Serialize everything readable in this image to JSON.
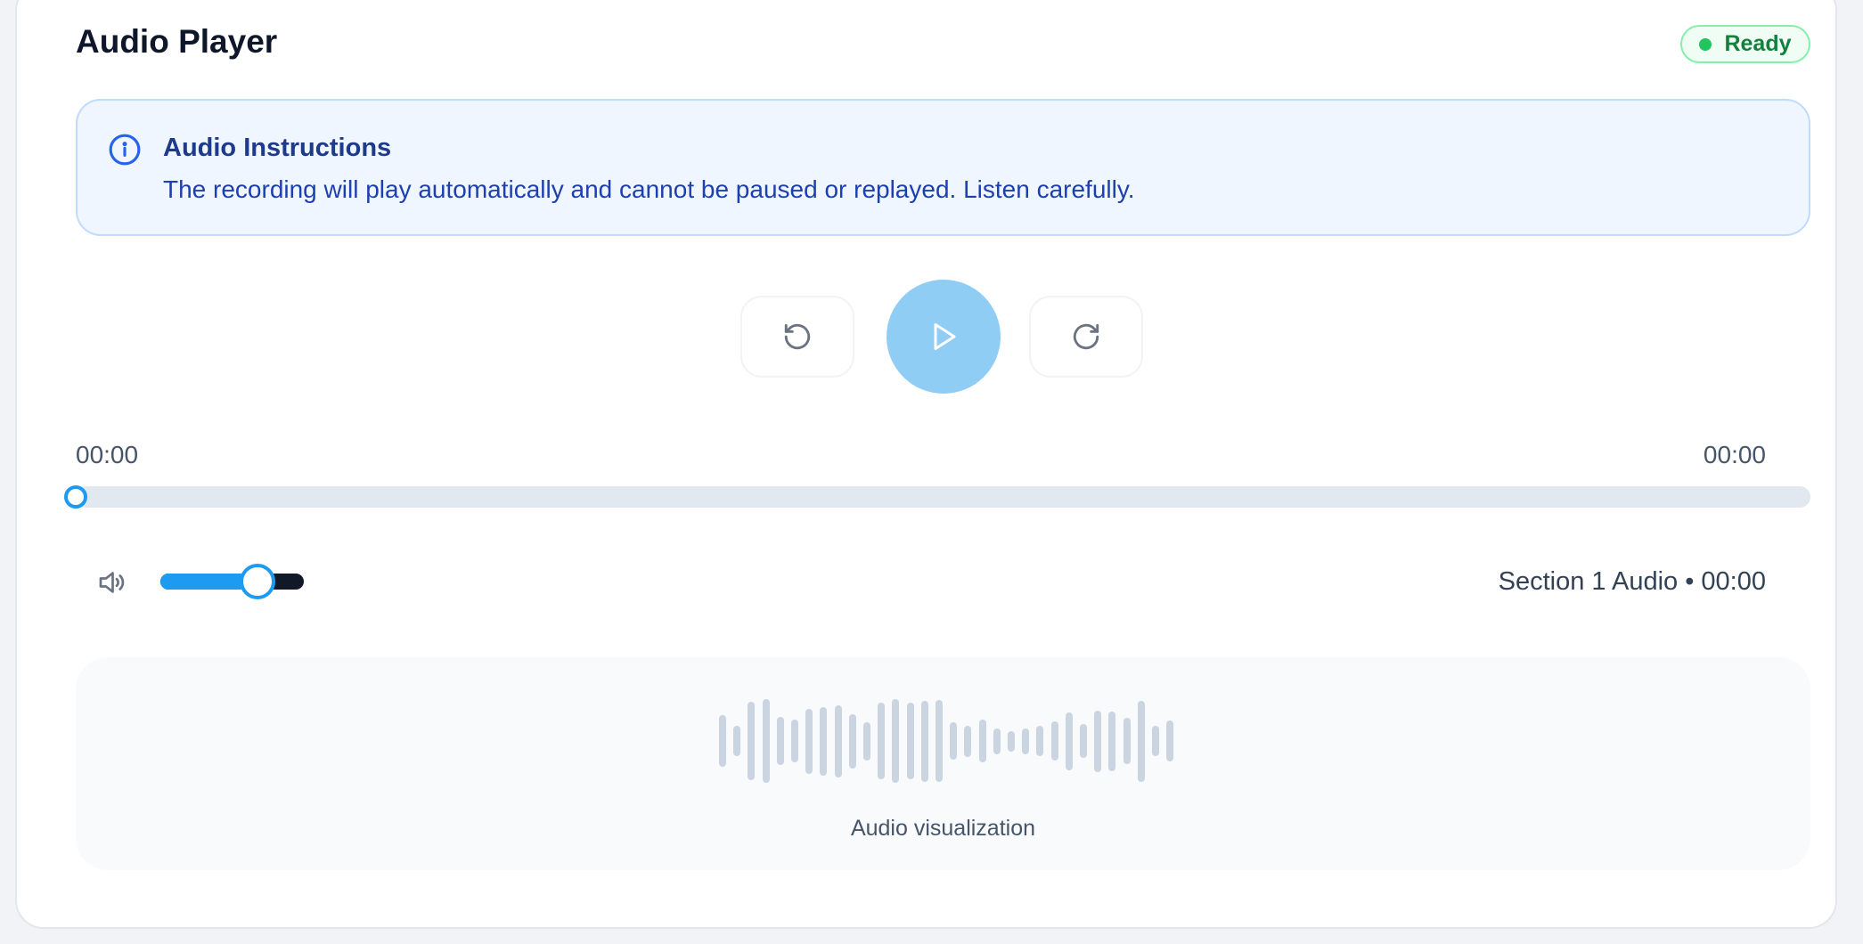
{
  "player": {
    "title": "Audio Player",
    "status": "Ready"
  },
  "instructions": {
    "title": "Audio Instructions",
    "text": "The recording will play automatically and cannot be paused or replayed. Listen carefully."
  },
  "controls": {
    "rewind_icon": "rotate-ccw-icon",
    "play_icon": "play-icon",
    "forward_icon": "rotate-cw-icon"
  },
  "progress": {
    "current_time": "00:00",
    "total_time": "00:00",
    "fraction": 0
  },
  "volume": {
    "icon": "volume-icon",
    "level": 0.68
  },
  "track": {
    "info": "Section 1 Audio • 00:00"
  },
  "visualization": {
    "label": "Audio visualization",
    "bar_heights": [
      0.6,
      0.35,
      0.92,
      0.98,
      0.56,
      0.5,
      0.76,
      0.8,
      0.84,
      0.64,
      0.45,
      0.9,
      0.98,
      0.9,
      0.95,
      0.96,
      0.44,
      0.36,
      0.5,
      0.3,
      0.24,
      0.3,
      0.35,
      0.46,
      0.68,
      0.4,
      0.72,
      0.7,
      0.54,
      0.95,
      0.35,
      0.48
    ],
    "colors": {
      "bar": "#cbd5e1",
      "accent": "#1d9bf0",
      "play": "#90cdf4"
    }
  }
}
